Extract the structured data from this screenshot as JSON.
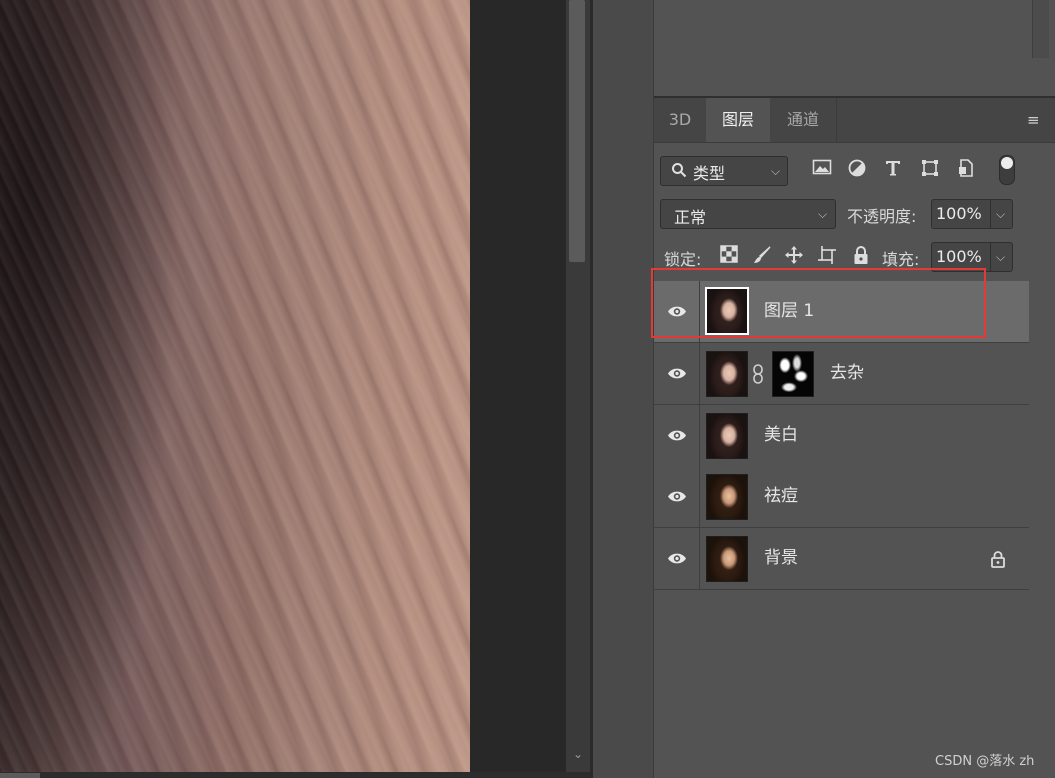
{
  "watermark": "CSDN @落水 zh",
  "tabs": [
    {
      "label": "3D",
      "active": false
    },
    {
      "label": "图层",
      "active": true
    },
    {
      "label": "通道",
      "active": false
    }
  ],
  "filter": {
    "value": "类型"
  },
  "blend": {
    "mode": "正常",
    "opacity_label": "不透明度:",
    "opacity_value": "100%"
  },
  "lock": {
    "label": "锁定:",
    "fill_label": "填充:",
    "fill_value": "100%"
  },
  "layers": [
    {
      "name": "图层 1",
      "visible": true,
      "selected": true,
      "has_mask": false,
      "locked": false
    },
    {
      "name": "去杂",
      "visible": true,
      "selected": false,
      "has_mask": true,
      "locked": false
    },
    {
      "name": "美白",
      "visible": true,
      "selected": false,
      "has_mask": false,
      "locked": false
    },
    {
      "name": "祛痘",
      "visible": true,
      "selected": false,
      "has_mask": false,
      "locked": false
    },
    {
      "name": "背景",
      "visible": true,
      "selected": false,
      "has_mask": false,
      "locked": true
    }
  ],
  "colors": {
    "highlight_box": "#e53935",
    "panel_bg": "#535353",
    "selected_row": "#6b6b6b"
  }
}
